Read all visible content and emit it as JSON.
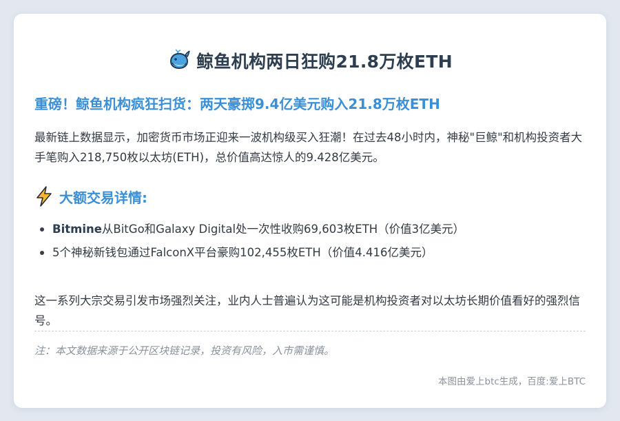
{
  "article": {
    "title": "鲸鱼机构两日狂购21.8万枚ETH",
    "title_icon": "whale-icon",
    "subtitle": "重磅！鲸鱼机构疯狂扫货：两天豪掷9.4亿美元购入21.8万枚ETH",
    "intro": "最新链上数据显示，加密货币市场正迎来一波机构级买入狂潮！在过去48小时内，神秘\"巨鲸\"和机构投资者大手笔购入218,750枚以太坊(ETH)，总价值高达惊人的9.428亿美元。",
    "section_icon": "lightning-icon",
    "section_title": "大额交易详情:",
    "items": [
      {
        "bold": "Bitmine",
        "text": "从BitGo和Galaxy Digital处一次性收购69,603枚ETH（价值3亿美元）"
      },
      {
        "bold": "",
        "text": "5个神秘新钱包通过FalconX平台豪购102,455枚ETH（价值4.416亿美元）"
      }
    ],
    "conclusion": "这一系列大宗交易引发市场强烈关注，业内人士普遍认为这可能是机构投资者对以太坊长期价值看好的强烈信号。",
    "note": "注：本文数据来源于公开区块链记录，投资有风险，入市需谨慎。",
    "footer": "本图由爱上btc生成，百度:爱上BTC"
  },
  "colors": {
    "background": "#e3e8f0",
    "card": "#ffffff",
    "title": "#2c3e50",
    "accent": "#3a8fd6",
    "body_text": "#333a44",
    "muted": "#8a929c"
  }
}
